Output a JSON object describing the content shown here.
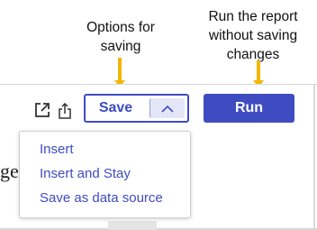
{
  "annotations": {
    "save_note": "Options for\nsaving",
    "run_note": "Run the report\nwithout saving\nchanges",
    "arrow_color": "#F2B705"
  },
  "toolbar": {
    "open_icon": "open-in-new-icon",
    "export_icon": "share-export-icon",
    "save_label": "Save",
    "save_toggle_icon": "chevron-up-icon",
    "run_label": "Run",
    "accent_color": "#3F4CC1"
  },
  "save_menu": {
    "items": [
      {
        "label": "Insert"
      },
      {
        "label": "Insert and Stay"
      },
      {
        "label": "Save as data source"
      }
    ]
  },
  "background": {
    "partial_text": "ge"
  }
}
